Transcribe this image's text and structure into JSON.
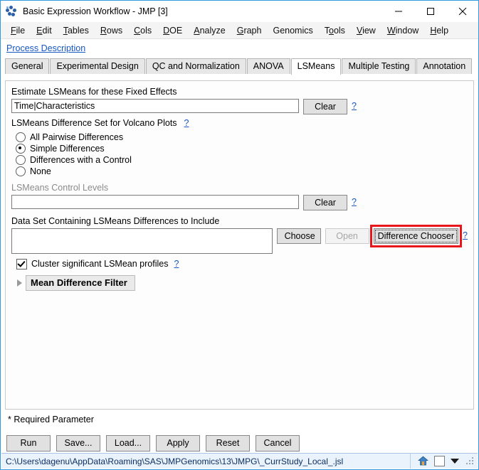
{
  "window": {
    "title": "Basic Expression Workflow - JMP [3]",
    "icon": "jmp-molecule-icon",
    "controls": {
      "minimize": "minimize-icon",
      "maximize": "maximize-icon",
      "close": "close-icon"
    }
  },
  "menubar": {
    "items": [
      {
        "label": "File",
        "accel": "F"
      },
      {
        "label": "Edit",
        "accel": "E"
      },
      {
        "label": "Tables",
        "accel": "T"
      },
      {
        "label": "Rows",
        "accel": "R"
      },
      {
        "label": "Cols",
        "accel": "C"
      },
      {
        "label": "DOE",
        "accel": "D"
      },
      {
        "label": "Analyze",
        "accel": "A"
      },
      {
        "label": "Graph",
        "accel": "G"
      },
      {
        "label": "Genomics",
        "accel": ""
      },
      {
        "label": "Tools",
        "accel": "o"
      },
      {
        "label": "View",
        "accel": "V"
      },
      {
        "label": "Window",
        "accel": "W"
      },
      {
        "label": "Help",
        "accel": "H"
      }
    ]
  },
  "process_link": "Process Description",
  "tabs": [
    {
      "label": "General",
      "active": false
    },
    {
      "label": "Experimental Design",
      "active": false
    },
    {
      "label": "QC and Normalization",
      "active": false
    },
    {
      "label": "ANOVA",
      "active": false
    },
    {
      "label": "LSMeans",
      "active": true
    },
    {
      "label": "Multiple Testing",
      "active": false
    },
    {
      "label": "Annotation",
      "active": false
    }
  ],
  "form": {
    "fixed_effects": {
      "label": "Estimate LSMeans for these Fixed Effects",
      "value": "Time|Characteristics",
      "placeholder": "",
      "clear_label": "Clear",
      "help": "?"
    },
    "difference_set": {
      "label": "LSMeans Difference Set for Volcano Plots",
      "help": "?",
      "options": [
        {
          "label": "All Pairwise Differences",
          "selected": false
        },
        {
          "label": "Simple Differences",
          "selected": true
        },
        {
          "label": "Differences with a Control",
          "selected": false
        },
        {
          "label": "None",
          "selected": false
        }
      ]
    },
    "control_levels": {
      "label": "LSMeans Control Levels",
      "disabled": true,
      "value": "",
      "placeholder": "",
      "clear_label": "Clear",
      "help": "?"
    },
    "data_set": {
      "label": "Data Set Containing LSMeans Differences to Include",
      "value": "",
      "placeholder": "",
      "choose_label": "Choose",
      "open_label": "Open",
      "open_disabled": true,
      "difference_chooser_label": "Difference Chooser",
      "difference_chooser_highlighted": true,
      "highlight_color": "#e8151b",
      "help": "?"
    },
    "cluster_checkbox": {
      "label": "Cluster significant LSMean profiles",
      "checked": true,
      "help": "?"
    },
    "mean_difference_filter": {
      "label": "Mean Difference Filter",
      "expanded": false
    }
  },
  "required_note": "* Required Parameter",
  "action_buttons": [
    {
      "label": "Run"
    },
    {
      "label": "Save..."
    },
    {
      "label": "Load..."
    },
    {
      "label": "Apply"
    },
    {
      "label": "Reset"
    },
    {
      "label": "Cancel"
    }
  ],
  "statusbar": {
    "path": "C:\\Users\\dagenu\\AppData\\Roaming\\SAS\\JMPGenomics\\13\\JMPG\\_CurrStudy_Local_.jsl",
    "home_icon": "home-icon",
    "box_icon": "white-square-icon",
    "caret_icon": "dropdown-caret-icon"
  }
}
